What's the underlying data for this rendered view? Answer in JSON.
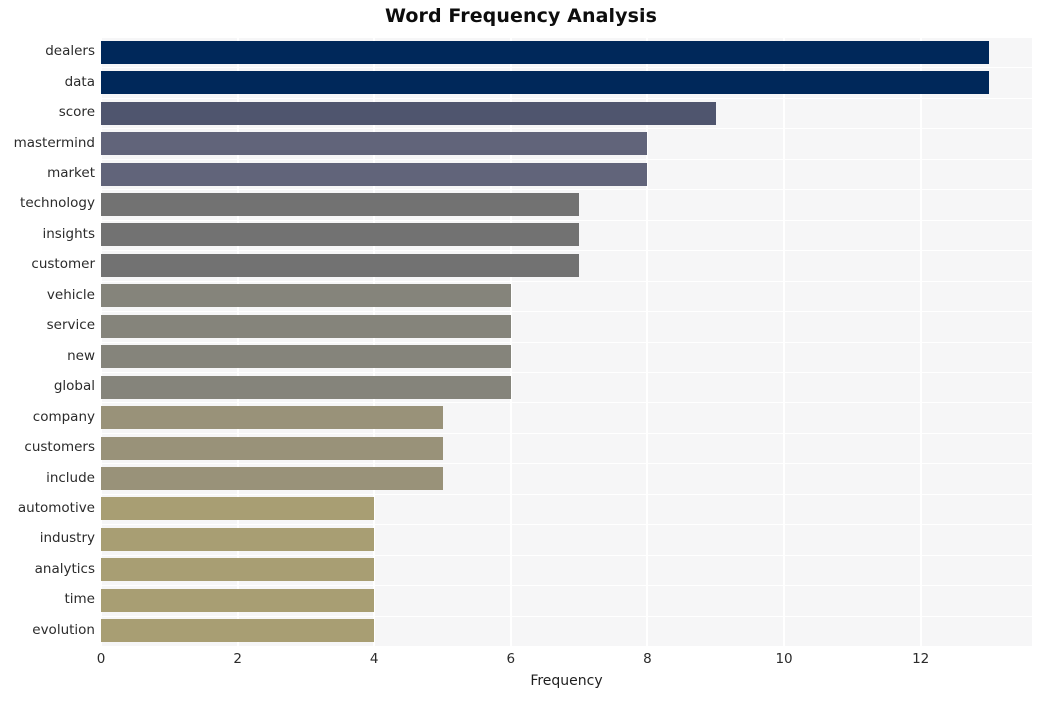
{
  "chart_data": {
    "type": "bar",
    "orientation": "horizontal",
    "title": "Word Frequency Analysis",
    "xlabel": "Frequency",
    "ylabel": "",
    "categories": [
      "dealers",
      "data",
      "score",
      "mastermind",
      "market",
      "technology",
      "insights",
      "customer",
      "vehicle",
      "service",
      "new",
      "global",
      "company",
      "customers",
      "include",
      "automotive",
      "industry",
      "analytics",
      "time",
      "evolution"
    ],
    "values": [
      13,
      13,
      9,
      8,
      8,
      7,
      7,
      7,
      6,
      6,
      6,
      6,
      5,
      5,
      5,
      4,
      4,
      4,
      4,
      4
    ],
    "bar_colors": [
      "#00285a",
      "#00285a",
      "#4f556e",
      "#61647a",
      "#61647a",
      "#727272",
      "#727272",
      "#727272",
      "#85847b",
      "#85847b",
      "#85847b",
      "#85847b",
      "#999279",
      "#999279",
      "#999279",
      "#a89e73",
      "#a89e73",
      "#a89e73",
      "#a89e73",
      "#a89e73"
    ],
    "xticks": [
      0,
      2,
      4,
      6,
      8,
      10,
      12
    ],
    "xlim": [
      0,
      13.63
    ],
    "grid": true,
    "legend": null,
    "style": {
      "plot_background": "#f6f6f7",
      "grid_color": "#ffffff",
      "figure_background": "#ffffff",
      "title_color": "#0d0d0d",
      "tick_color": "#2b2b2b"
    }
  }
}
